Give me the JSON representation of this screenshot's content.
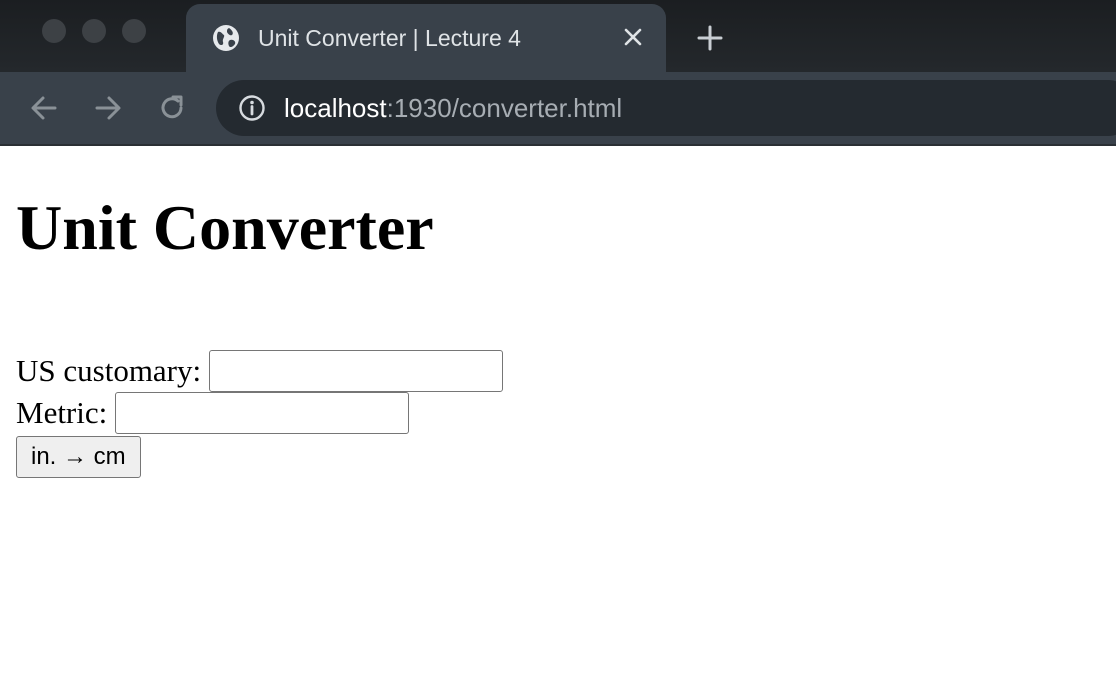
{
  "browser": {
    "tab": {
      "title": "Unit Converter | Lecture 4"
    },
    "address_bar": {
      "host": "localhost",
      "path": ":1930/converter.html"
    }
  },
  "page": {
    "heading": "Unit Converter",
    "us_customary": {
      "label": "US customary:",
      "value": ""
    },
    "metric": {
      "label": "Metric:",
      "value": ""
    },
    "convert_button": {
      "label": "in. → cm"
    }
  },
  "icons": {
    "tab_favicon": "globe-icon",
    "tab_close": "close-icon",
    "new_tab": "plus-icon",
    "back": "arrow-left-icon",
    "forward": "arrow-right-icon",
    "reload": "reload-icon",
    "site_info": "info-icon"
  },
  "colors": {
    "chrome_dark": "#1f2327",
    "chrome_tab": "#39414a",
    "omnibox": "#242a30",
    "url_host": "#ffffff",
    "url_path": "#a7adb3"
  }
}
